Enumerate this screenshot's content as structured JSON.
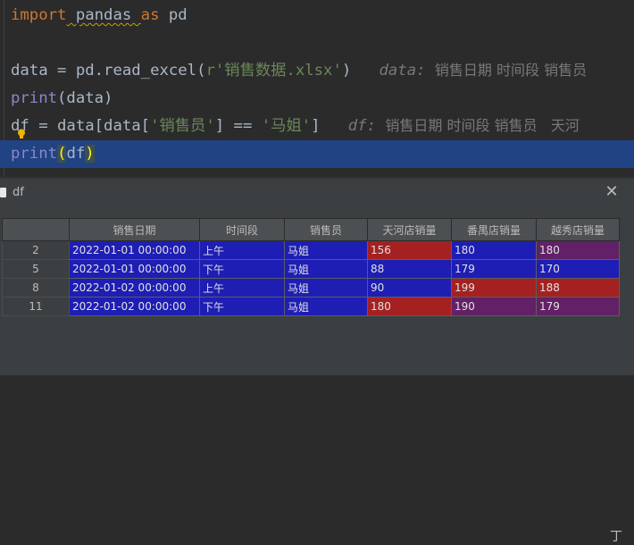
{
  "editor": {
    "line1": {
      "kw": "import",
      "rest": " pandas ",
      "kw2": "as",
      "rest2": " pd"
    },
    "line3": {
      "a": "data = pd.read_excel(",
      "str": "r'销售数据.xlsx'",
      "b": ")",
      "hint_label": "data:",
      "hint_text": "销售日期 时间段 销售员"
    },
    "line4": {
      "fn": "print",
      "rest": "(data)"
    },
    "line5": {
      "a": "df = data[data[",
      "str": "'销售员'",
      "b": "] == ",
      "str2": "'马姐'",
      "c": "]",
      "hint_label": "df:",
      "hint_text": "销售日期 时间段 销售员   天河"
    },
    "line6": {
      "fn": "print",
      "open": "(",
      "mid": "df",
      "close": ")"
    }
  },
  "pane": {
    "title": "df",
    "close_icon": "close-icon"
  },
  "table": {
    "columns": [
      "",
      "销售日期",
      "时间段",
      "销售员",
      "天河店销量",
      "番禺店销量",
      "越秀店销量"
    ],
    "rows": [
      {
        "idx": "2",
        "date": "2022-01-01 00:00:00",
        "period": "上午",
        "seller": "马姐",
        "tianhe": "156",
        "panyu": "180",
        "yuexiu": "180"
      },
      {
        "idx": "5",
        "date": "2022-01-01 00:00:00",
        "period": "下午",
        "seller": "马姐",
        "tianhe": "88",
        "panyu": "179",
        "yuexiu": "170"
      },
      {
        "idx": "8",
        "date": "2022-01-02 00:00:00",
        "period": "上午",
        "seller": "马姐",
        "tianhe": "90",
        "panyu": "199",
        "yuexiu": "188"
      },
      {
        "idx": "11",
        "date": "2022-01-02 00:00:00",
        "period": "下午",
        "seller": "马姐",
        "tianhe": "180",
        "panyu": "190",
        "yuexiu": "179"
      }
    ]
  },
  "corner_text": "丁",
  "colors": {
    "blue": "#1e1eb4",
    "red": "#a52121",
    "purple": "#622166",
    "selection": "#214283"
  }
}
